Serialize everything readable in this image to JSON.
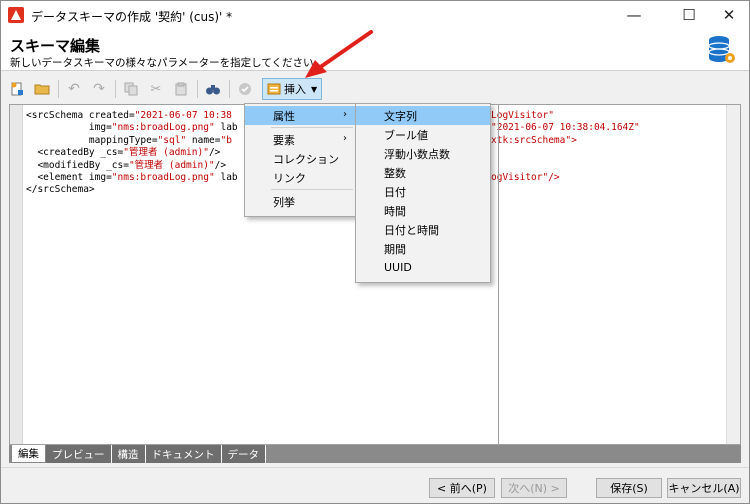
{
  "window": {
    "title": "データスキーマの作成 '契約' (cus)' *",
    "min": "—",
    "max": "☐",
    "close": "✕"
  },
  "header": {
    "title": "スキーマ編集",
    "subtitle": "新しいデータスキーマの様々なパラメーターを指定してください。"
  },
  "toolbar": {
    "insert_label": "挿入"
  },
  "code_lines": [
    [
      "<srcSchema created=",
      "\"2021-06-07 10:38",
      "",
      "",
      "LogVisitor\""
    ],
    [
      "           img=",
      "\"nms:broadLog.png\"",
      " lab",
      "",
      "\"2021-06-07 10:38:04.164Z\""
    ],
    [
      "           mappingType=",
      "\"sql\"",
      " name=",
      "\"b",
      "xtk:srcSchema\">"
    ],
    [
      "  <createdBy _cs=",
      "\"管理者 (admin)\"",
      "/>",
      "",
      ""
    ],
    [
      "  <modifiedBy _cs=",
      "\"管理者 (admin)\"",
      "/>",
      "",
      ""
    ],
    [
      "  <element img=",
      "\"nms:broadLog.png\"",
      " lab",
      "",
      "ogVisitor\"/>"
    ],
    [
      "</srcSchema>",
      "",
      "",
      "",
      ""
    ]
  ],
  "menu": {
    "items": [
      "属性",
      "要素",
      "コレクション",
      "リンク",
      "列挙"
    ]
  },
  "submenu": {
    "items": [
      "文字列",
      "ブール値",
      "浮動小数点数",
      "整数",
      "日付",
      "時間",
      "日付と時間",
      "期間",
      "UUID"
    ]
  },
  "tabs": [
    "編集",
    "プレビュー",
    "構造",
    "ドキュメント",
    "データ"
  ],
  "buttons": {
    "prev": "< 前へ(P)",
    "next": "次へ(N) >",
    "save": "保存(S)",
    "cancel": "キャンセル(A)"
  },
  "colors": {
    "highlight": "#91c9f7",
    "string": "#c00000",
    "arrow": "#e0201a"
  }
}
